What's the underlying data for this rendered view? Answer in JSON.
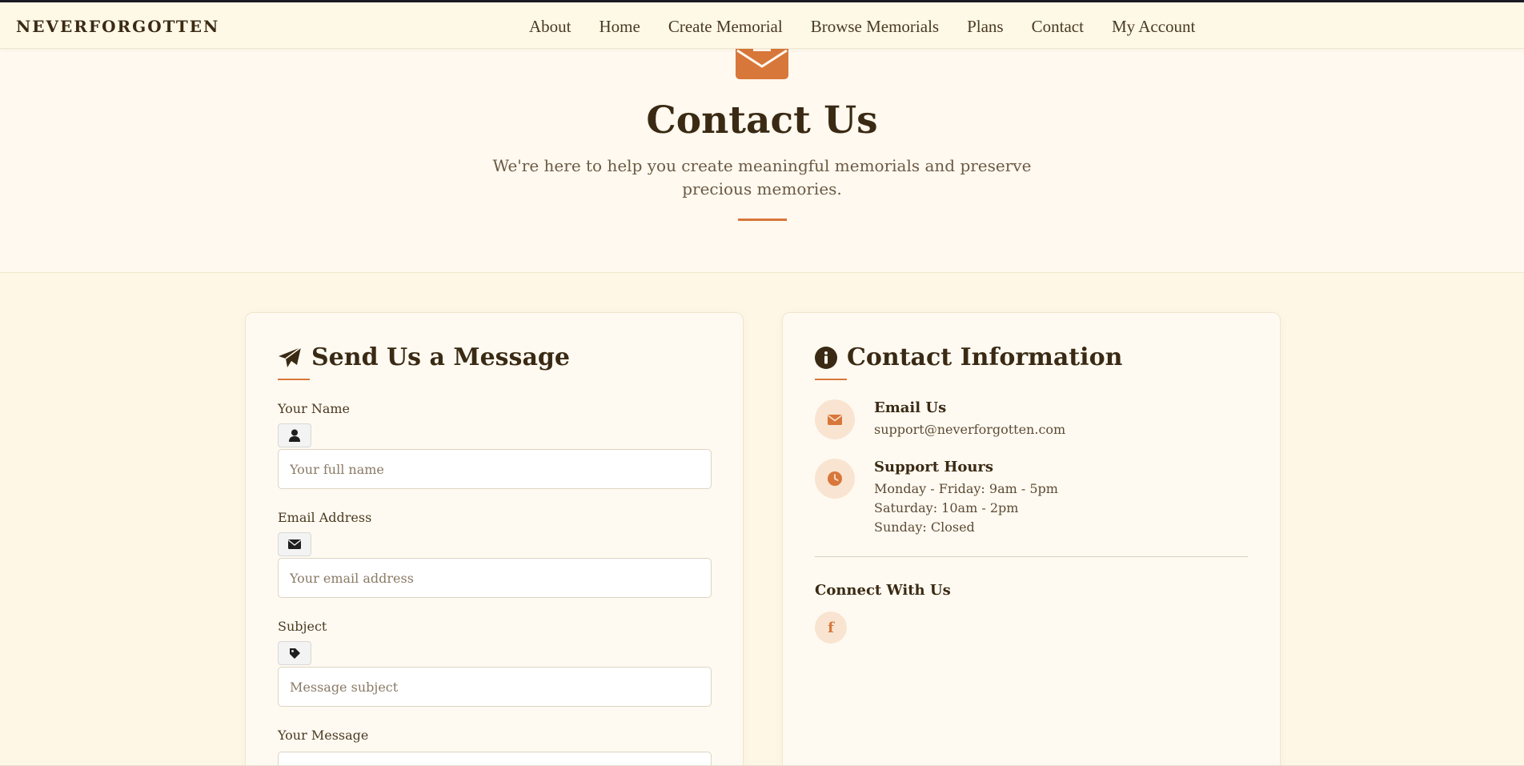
{
  "brand": {
    "name": "NEVERFORGOTTEN"
  },
  "nav": {
    "items": [
      {
        "label": "About"
      },
      {
        "label": "Home"
      },
      {
        "label": "Create Memorial"
      },
      {
        "label": "Browse Memorials"
      },
      {
        "label": "Plans"
      },
      {
        "label": "Contact"
      },
      {
        "label": "My Account"
      }
    ]
  },
  "hero": {
    "icon": "envelope-open-icon",
    "title": "Contact Us",
    "subtitle": "We're here to help you create meaningful memorials and preserve precious memories."
  },
  "form": {
    "icon": "paper-plane-icon",
    "title": "Send Us a Message",
    "name": {
      "label": "Your Name",
      "icon": "user-icon",
      "placeholder": "Your full name"
    },
    "email": {
      "label": "Email Address",
      "icon": "envelope-icon",
      "placeholder": "Your email address"
    },
    "subject": {
      "label": "Subject",
      "icon": "tag-icon",
      "placeholder": "Message subject"
    },
    "message": {
      "label": "Your Message"
    }
  },
  "info": {
    "icon": "info-circle-icon",
    "title": "Contact Information",
    "email": {
      "icon": "envelope-icon",
      "heading": "Email Us",
      "value": "support@neverforgotten.com"
    },
    "hours": {
      "icon": "clock-icon",
      "heading": "Support Hours",
      "lines": [
        "Monday - Friday: 9am - 5pm",
        "Saturday: 10am - 2pm",
        "Sunday: Closed"
      ]
    },
    "connect": {
      "heading": "Connect With Us",
      "facebook_glyph": "f",
      "facebook_icon": "facebook-icon"
    }
  },
  "colors": {
    "accent": "#d8773a",
    "text_dark": "#3a2a14",
    "page_bg": "#fef7e6",
    "card_bg": "#fffaf1",
    "icon_circle_bg": "#f9e4d1"
  }
}
